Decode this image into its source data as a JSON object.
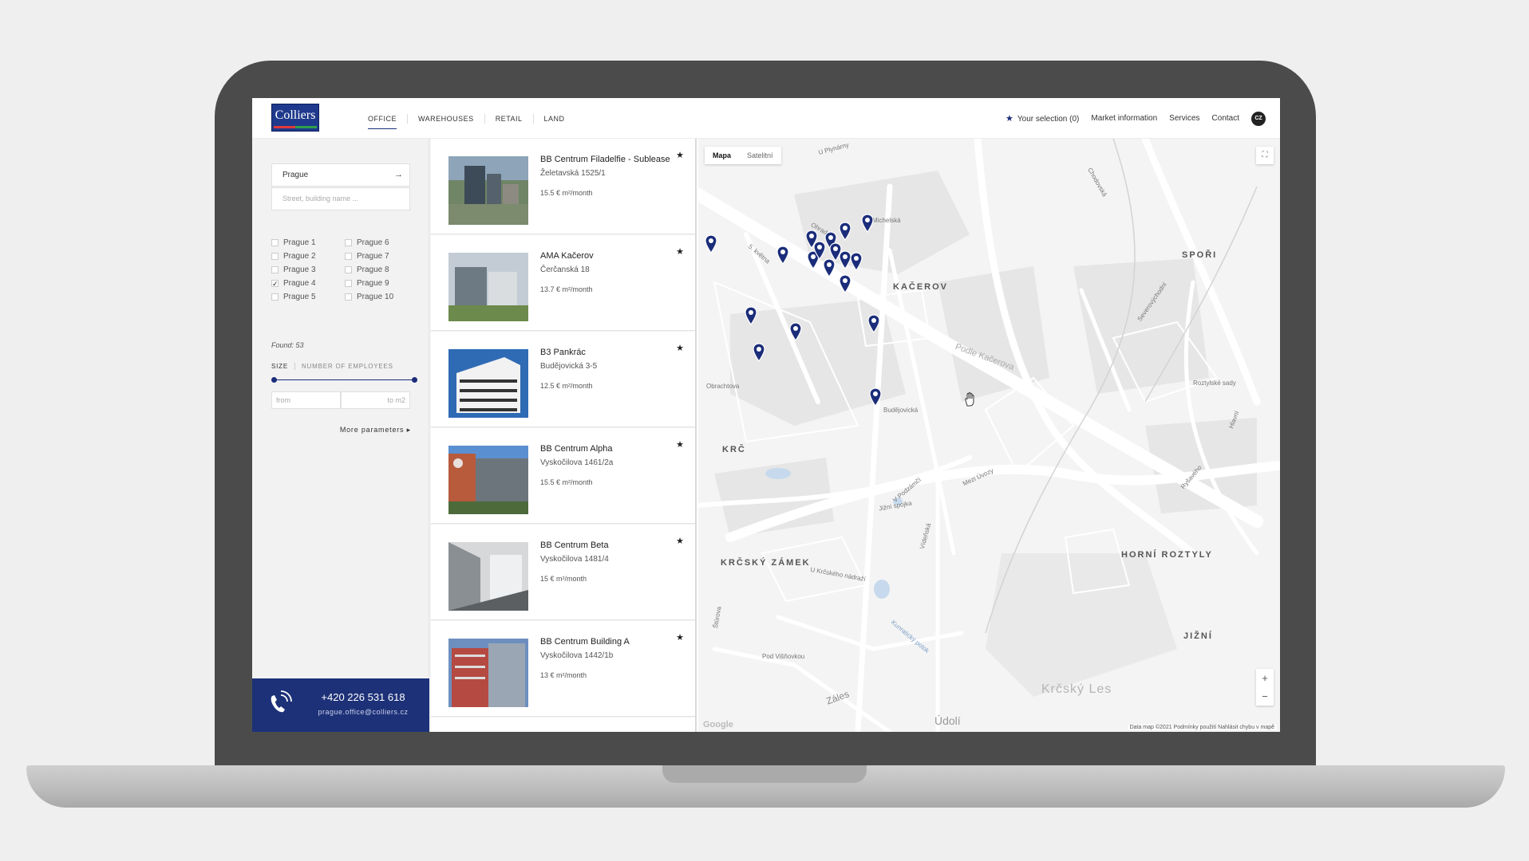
{
  "header": {
    "logo_text": "Colliers",
    "nav": [
      "OFFICE",
      "WAREHOUSES",
      "RETAIL",
      "LAND"
    ],
    "selection": "Your selection (0)",
    "links": [
      "Market information",
      "Services",
      "Contact"
    ],
    "lang": "CZ"
  },
  "filters": {
    "city": "Prague",
    "street_placeholder": "Street, building name ...",
    "districts": [
      {
        "label": "Prague 1",
        "checked": false
      },
      {
        "label": "Prague 6",
        "checked": false
      },
      {
        "label": "Prague 2",
        "checked": false
      },
      {
        "label": "Prague 7",
        "checked": false
      },
      {
        "label": "Prague 3",
        "checked": false
      },
      {
        "label": "Prague 8",
        "checked": false
      },
      {
        "label": "Prague 4",
        "checked": true
      },
      {
        "label": "Prague 9",
        "checked": false
      },
      {
        "label": "Prague 5",
        "checked": false
      },
      {
        "label": "Prague 10",
        "checked": false
      }
    ],
    "found": "Found: 53",
    "size_tab": "SIZE",
    "employees_tab": "NUMBER OF EMPLOYEES",
    "from_placeholder": "from",
    "to_placeholder": "to m2",
    "more": "More parameters"
  },
  "contact": {
    "phone": "+420 226 531 618",
    "email": "prague.office@colliers.cz"
  },
  "listings": [
    {
      "title": "BB Centrum Filadelfie - Sublease",
      "address": "Želetavská 1525/1",
      "price": "15.5 € m²/month"
    },
    {
      "title": "AMA Kačerov",
      "address": "Čerčanská 18",
      "price": "13.7 € m²/month"
    },
    {
      "title": "B3 Pankrác",
      "address": "Budějovická 3-5",
      "price": "12.5 € m²/month"
    },
    {
      "title": "BB Centrum Alpha",
      "address": "Vyskočilova 1461/2a",
      "price": "15.5 € m²/month"
    },
    {
      "title": "BB Centrum Beta",
      "address": "Vyskočilova 1481/4",
      "price": "15 € m²/month"
    },
    {
      "title": "BB Centrum Building A",
      "address": "Vyskočilova 1442/1b",
      "price": "13 € m²/month"
    }
  ],
  "map": {
    "tabs": [
      "Mapa",
      "Satelitní"
    ],
    "labels": [
      "KAČEROV",
      "KRČ",
      "KRČSKÝ ZÁMEK",
      "SPOŘI",
      "HORNÍ ROZTYLY",
      "JIŽNÍ"
    ],
    "streets": [
      "5. května",
      "Michelská",
      "Budějovická",
      "Obrachtova",
      "Jižní spojka",
      "Mezi Úvozy",
      "Severovýchodní",
      "Roztylské sady",
      "Hlavní",
      "U Plynárny",
      "Chodovská",
      "Podle Kačerova",
      "Vídeňská",
      "U Krčského nádraží",
      "Pod Višňovkou",
      "Záles",
      "Údolí",
      "Krčský Les",
      "Kunratický potok",
      "V Podzámčí",
      "Štúrova",
      "Ryšavého",
      "Ohradní"
    ],
    "attribution": "Data map ©2021   Podmínky použití   Nahlásit chybu v mapě",
    "google": "Google",
    "zoom_in": "+",
    "zoom_out": "−",
    "pin_color": "#1b2d7a"
  }
}
